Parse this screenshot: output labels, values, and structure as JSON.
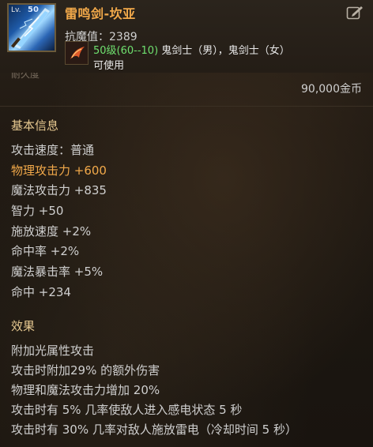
{
  "header": {
    "item_name": "雷鸣剑-坎亚",
    "lv_tag": "Lv.",
    "grade_tag": "50",
    "anti_magic": "抗魔值：2389",
    "req_level": "50级(60--10)",
    "req_classes": " 鬼剑士（男），鬼剑士（女）",
    "usable": "可使用",
    "icon": "lightning-sword-icon",
    "class_icon": "class-emblem-icon",
    "edit_icon": "edit-icon"
  },
  "partial_text": "耐久度",
  "price": "90,000金币",
  "basic_info": {
    "title": "基本信息",
    "stats": [
      {
        "text": "攻击速度：普通",
        "highlight": false
      },
      {
        "text": "物理攻击力 +600",
        "highlight": true
      },
      {
        "text": "魔法攻击力 +835",
        "highlight": false
      },
      {
        "text": "智力 +50",
        "highlight": false
      },
      {
        "text": "施放速度 +2%",
        "highlight": false
      },
      {
        "text": "命中率 +2%",
        "highlight": false
      },
      {
        "text": "魔法暴击率 +5%",
        "highlight": false
      },
      {
        "text": "命中 +234",
        "highlight": false
      }
    ]
  },
  "effects": {
    "title": "效果",
    "items": [
      "附加光属性攻击",
      "攻击时附加29% 的额外伤害",
      "物理和魔法攻击力增加 20%",
      "攻击时有 5% 几率使敌人进入感电状态 5 秒",
      "攻击时有 30% 几率对敌人施放雷电（冷却时间 5 秒）"
    ]
  },
  "colors": {
    "name": "#f2a94a",
    "highlight": "#f2a94a",
    "req_level": "#6fe06f",
    "section_title": "#e6c890",
    "text": "#cfcfcf"
  }
}
